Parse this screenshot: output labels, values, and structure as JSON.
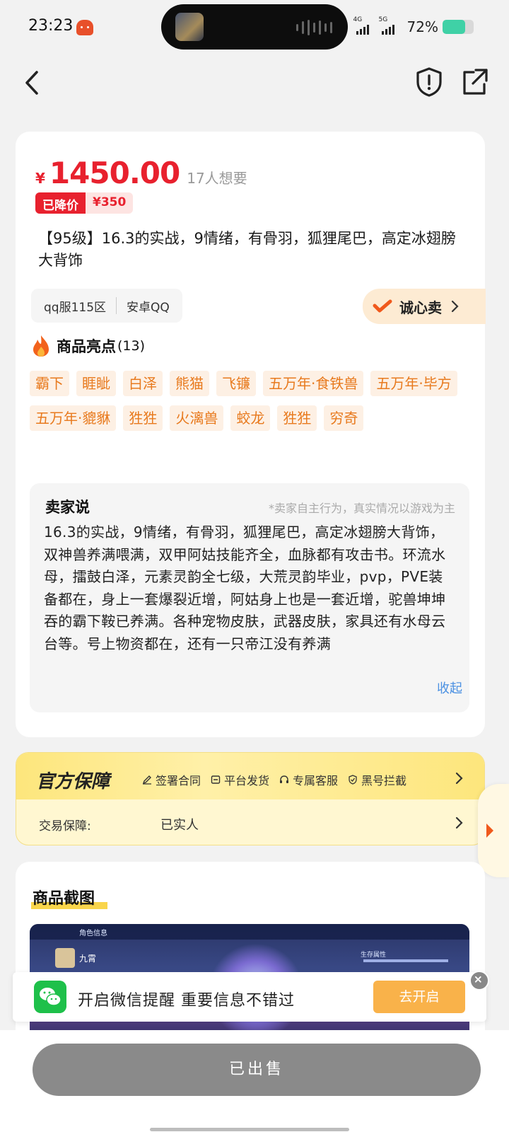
{
  "status": {
    "time": "23:23",
    "net1": "4G",
    "net2": "5G",
    "battery_text": "72%",
    "battery_level": 0.72,
    "battery_color": "#3fd1a6"
  },
  "nav": {
    "back_icon": "chevron-left-icon",
    "report_icon": "shield-alert-icon",
    "share_icon": "share-icon"
  },
  "product": {
    "price_symbol": "¥",
    "price": "1450.00",
    "want_count": "17人想要",
    "drop_label": "已降价",
    "drop_amount": "¥350",
    "title": "【95级】16.3的实战，9情绪，有骨羽，狐狸尾巴，高定冰翅膀大背饰",
    "server": "qq服115区",
    "platform": "安卓QQ",
    "sincere_label": "诚心卖",
    "accent_color": "#e8212e"
  },
  "highlights": {
    "title": "商品亮点",
    "count": "(13)",
    "tags": [
      "霸下",
      "睚眦",
      "白泽",
      "熊猫",
      "飞镰",
      "五万年·食铁兽",
      "五万年·毕方",
      "五万年·貔貅",
      "狌狌",
      "火漓兽",
      "蛟龙",
      "狌狌",
      "穷奇"
    ]
  },
  "seller": {
    "title": "卖家说",
    "note": "*卖家自主行为，真实情况以游戏为主",
    "body": "16.3的实战，9情绪，有骨羽，狐狸尾巴，高定冰翅膀大背饰，双神兽养满喂满，双甲阿姑技能齐全，血脉都有攻击书。环流水母，擂鼓白泽，元素灵韵全七级，大荒灵韵毕业，pvp，PVE装备都在，身上一套爆裂近增，阿姑身上也是一套近增，驼兽坤坤吞的霸下鞍已养满。各种宠物皮肤，武器皮肤，家具还有水母云台等。号上物资都在，还有一只帝江没有养满",
    "collapse": "收起"
  },
  "guarantee": {
    "title": "官方保障",
    "items": [
      "签署合同",
      "平台发货",
      "专属客服",
      "黑号拦截"
    ],
    "trade_label": "交易保障:",
    "trade_value": "已实人"
  },
  "screenshots": {
    "title": "商品截图",
    "preview_label": "角色信息",
    "preview_name": "九霄",
    "preview_stat": "生存属性"
  },
  "wechat": {
    "text": "开启微信提醒 重要信息不错过",
    "button": "去开启"
  },
  "bottom": {
    "sold_label": "已出售"
  }
}
